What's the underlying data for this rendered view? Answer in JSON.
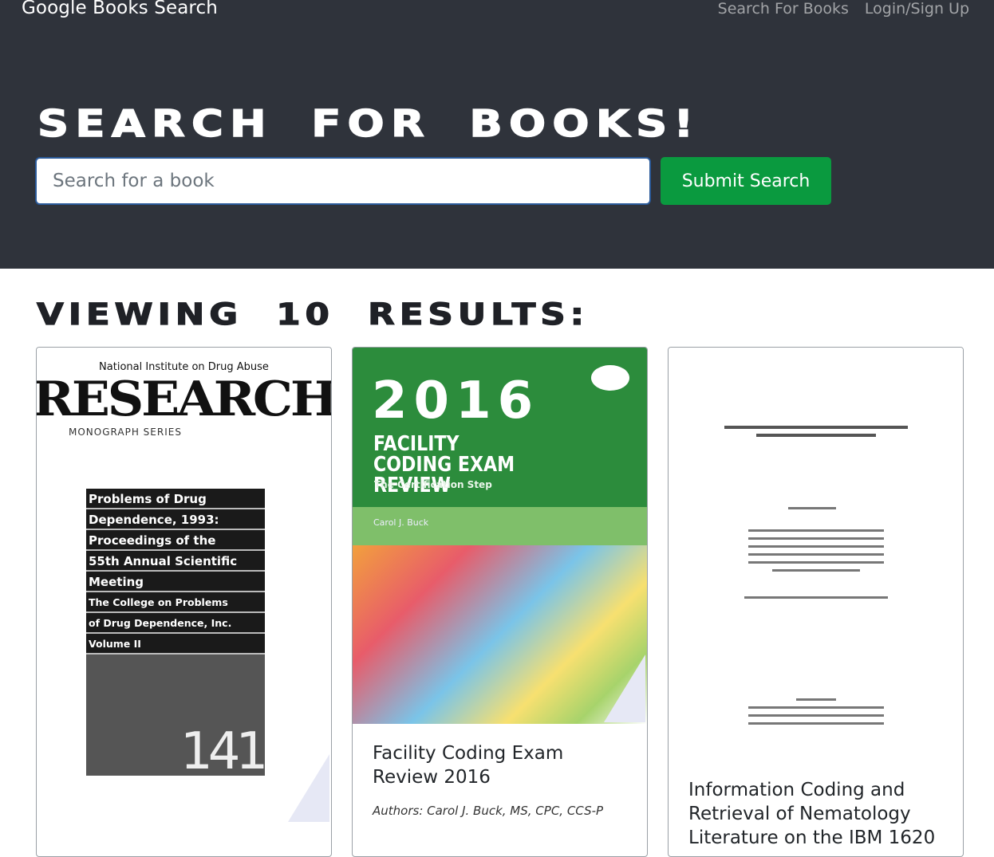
{
  "navbar": {
    "brand": "Google Books Search",
    "links": [
      "Search For Books",
      "Login/Sign Up"
    ]
  },
  "hero": {
    "title": "Search For Books!",
    "search_placeholder": "Search for a book",
    "submit_label": "Submit Search"
  },
  "results": {
    "heading": "Viewing 10 results:",
    "books": [
      {
        "title": "",
        "authors": "",
        "cover": {
          "top": "National Institute on Drug Abuse",
          "masthead": "RESEARCH",
          "series": "MONOGRAPH SERIES",
          "lines": [
            "Problems of Drug",
            "Dependence, 1993:",
            "Proceedings of the",
            "55th Annual Scientific",
            "Meeting",
            "The College on Problems",
            "of Drug Dependence, Inc.",
            "Volume II"
          ],
          "number": "141"
        }
      },
      {
        "title": "Facility Coding Exam Review 2016",
        "authors": "Authors: Carol J. Buck, MS, CPC, CCS-P",
        "cover": {
          "year": "2016",
          "title": "FACILITY CODING EXAM REVIEW",
          "subtitle": "The Certification Step",
          "author": "Carol J. Buck"
        }
      },
      {
        "title": "Information Coding and Retrieval of Nematology Literature on the IBM 1620",
        "authors": ""
      }
    ]
  },
  "colors": {
    "hero_bg": "#2f333b",
    "submit_bg": "#0a9a3f"
  }
}
